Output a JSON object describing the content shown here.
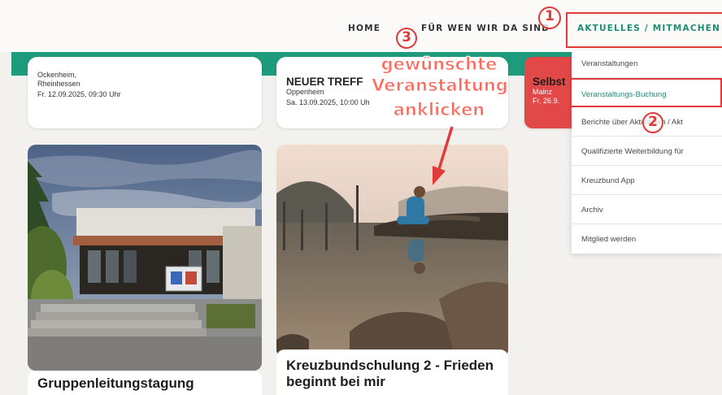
{
  "nav": {
    "home": "HOME",
    "fuer_wen": "FÜR WEN WIR DA SIND",
    "aktuelles": "AKTUELLES / MITMACHEN"
  },
  "top_cards": [
    {
      "place": "Ockenheim,",
      "region": "Rheinhessen",
      "date": "Fr. 12.09.2025, 09:30 Uhr"
    },
    {
      "title": "NEUER TREFF ",
      "place": "Oppenheim",
      "date": "Sa. 13.09.2025, 10:00 Uh"
    },
    {
      "title": "Selbst",
      "place": "Mainz",
      "date": "Fr. 26.9."
    }
  ],
  "image_cards": [
    {
      "title": "Gruppenleitungstagung"
    },
    {
      "title": "Kreuzbundschulung 2 - Frieden beginnt bei mir"
    }
  ],
  "dropdown": {
    "items": [
      "Veranstaltungen",
      "Veranstaltungs-Buchung",
      "Berichte über Aktivitäten / Akt",
      "Qualifizierte Weiterbildung für",
      "Kreuzbund App",
      "Archiv",
      "Mitglied werden"
    ],
    "selected_index": 1
  },
  "annotations": {
    "callout_line1": "gewünschte",
    "callout_line2": "Veranstaltung",
    "callout_line3": "anklicken",
    "step1": "1",
    "step2": "2",
    "step3": "3"
  },
  "colors": {
    "brand_green": "#1e9a7c",
    "annotation_red": "#e03a3a",
    "card_red": "#e24848"
  }
}
